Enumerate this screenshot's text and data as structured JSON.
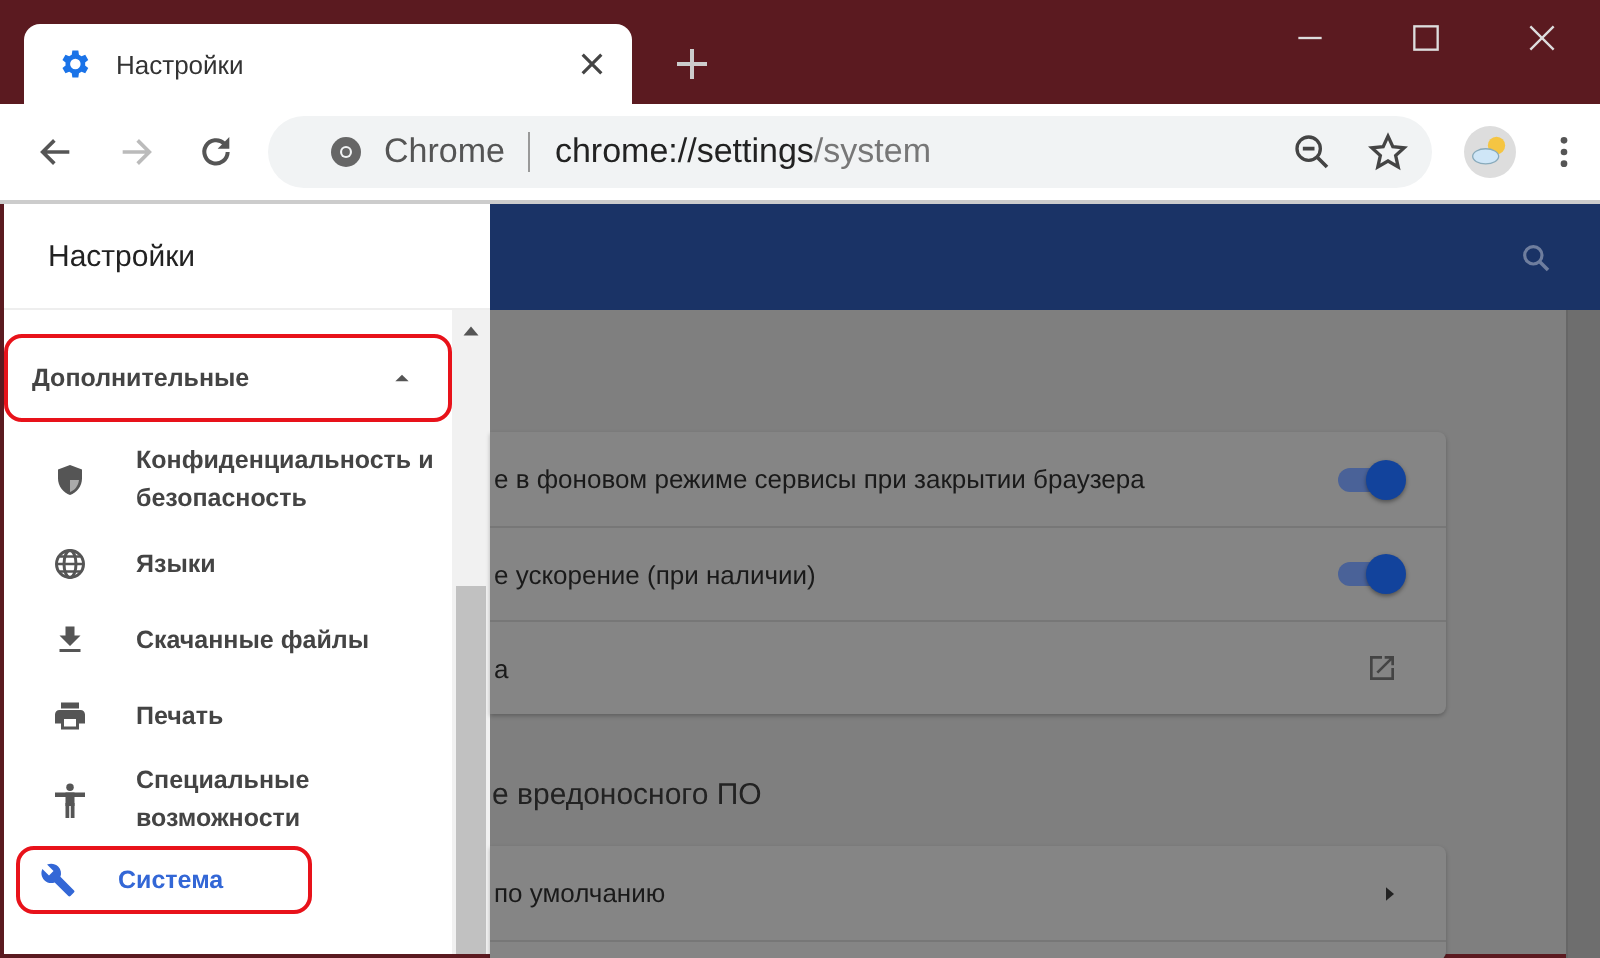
{
  "window": {
    "tab": {
      "title": "Настройки",
      "selected": true
    }
  },
  "toolbar": {
    "site_label": "Chrome",
    "url_host": "chrome://settings",
    "url_path": "/system"
  },
  "drawer": {
    "title": "Настройки",
    "items": [
      {
        "kind": "section",
        "label": "Дополнительные",
        "expanded": true,
        "highlighted": true,
        "selected": false
      },
      {
        "kind": "item",
        "label": "Конфиденциальность и безопасность",
        "highlighted": false,
        "selected": false
      },
      {
        "kind": "item",
        "label": "Языки",
        "highlighted": false,
        "selected": false
      },
      {
        "kind": "item",
        "label": "Скачанные файлы",
        "highlighted": false,
        "selected": false
      },
      {
        "kind": "item",
        "label": "Печать",
        "highlighted": false,
        "selected": false
      },
      {
        "kind": "item",
        "label": "Специальные возможности",
        "highlighted": false,
        "selected": false
      },
      {
        "kind": "item",
        "label": "Система",
        "highlighted": true,
        "selected": true
      }
    ]
  },
  "main": {
    "cards": [
      {
        "rows": [
          {
            "kind": "toggle",
            "label": "е в фоновом режиме сервисы при закрытии браузера",
            "on": true
          },
          {
            "kind": "toggle",
            "label": "е ускорение (при наличии)",
            "on": true
          },
          {
            "kind": "link",
            "label": "а"
          }
        ]
      },
      {
        "heading": "е вредоносного ПО",
        "rows": [
          {
            "kind": "arrow",
            "label": "по умолчанию"
          },
          {
            "kind": "empty"
          }
        ]
      }
    ]
  }
}
